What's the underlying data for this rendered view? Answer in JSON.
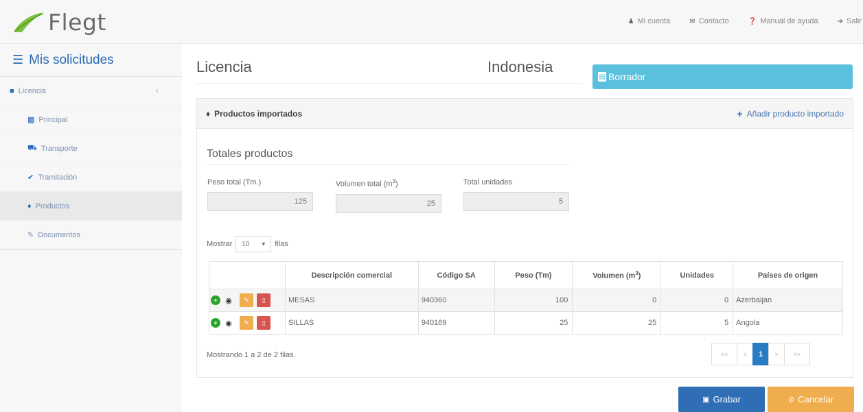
{
  "header": {
    "logo_text": "Flegt",
    "nav": [
      {
        "icon": "user-icon",
        "label": "Mi cuenta"
      },
      {
        "icon": "envelope-icon",
        "label": "Contacto"
      },
      {
        "icon": "help-icon",
        "label": "Manual de ayuda"
      },
      {
        "icon": "sign-out-icon",
        "label": "Salir"
      }
    ]
  },
  "sidebar": {
    "title": "Mis solicitudes",
    "section": "Licencia",
    "items": [
      {
        "icon": "file-icon",
        "label": "Principal"
      },
      {
        "icon": "truck-icon",
        "label": "Transporte"
      },
      {
        "icon": "check-icon",
        "label": "Tramitación"
      },
      {
        "icon": "cubes-icon",
        "label": "Productos"
      },
      {
        "icon": "paperclip-icon",
        "label": "Documentos"
      }
    ]
  },
  "page": {
    "title": "Licencia",
    "country": "Indonesia",
    "status": "Borrador"
  },
  "panel": {
    "title": "Productos importados",
    "add_label": "Añadir producto importado",
    "totals_title": "Totales productos",
    "fields": {
      "peso_label": "Peso total (Tm.)",
      "peso_value": "125",
      "volumen_label": "Volumen total (m",
      "volumen_sup": "3",
      "volumen_close": ")",
      "volumen_value": "25",
      "unidades_label": "Total unidades",
      "unidades_value": "5"
    },
    "mostrar_pre": "Mostrar",
    "mostrar_value": "10",
    "mostrar_post": "filas",
    "table": {
      "headers": [
        "",
        "Descripción comercial",
        "Código SA",
        "Peso (Tm)",
        "Volumen (m",
        "Unidades",
        "Países de origen"
      ],
      "header_sup": "3",
      "header_sup_close": ")",
      "rows": [
        {
          "descripcion": "MESAS",
          "codigo": "940360",
          "peso": "100",
          "volumen": "0",
          "unidades": "0",
          "pais": "Azerbaijan"
        },
        {
          "descripcion": "SILLAS",
          "codigo": "940169",
          "peso": "25",
          "volumen": "25",
          "unidades": "5",
          "pais": "Angola"
        }
      ]
    },
    "showing": "Mostrando 1 a 2 de 2 filas.",
    "pager": {
      "first": "<<",
      "prev": "<",
      "current": "1",
      "next": ">",
      "last": ">>"
    }
  },
  "actions": {
    "save": "Grabar",
    "cancel": "Cancelar"
  },
  "colors": {
    "brand_blue": "#2a6ab7",
    "status_info": "#5bc0de",
    "warning": "#f0ad4e",
    "danger": "#d9534f",
    "success": "#2aa32a"
  }
}
